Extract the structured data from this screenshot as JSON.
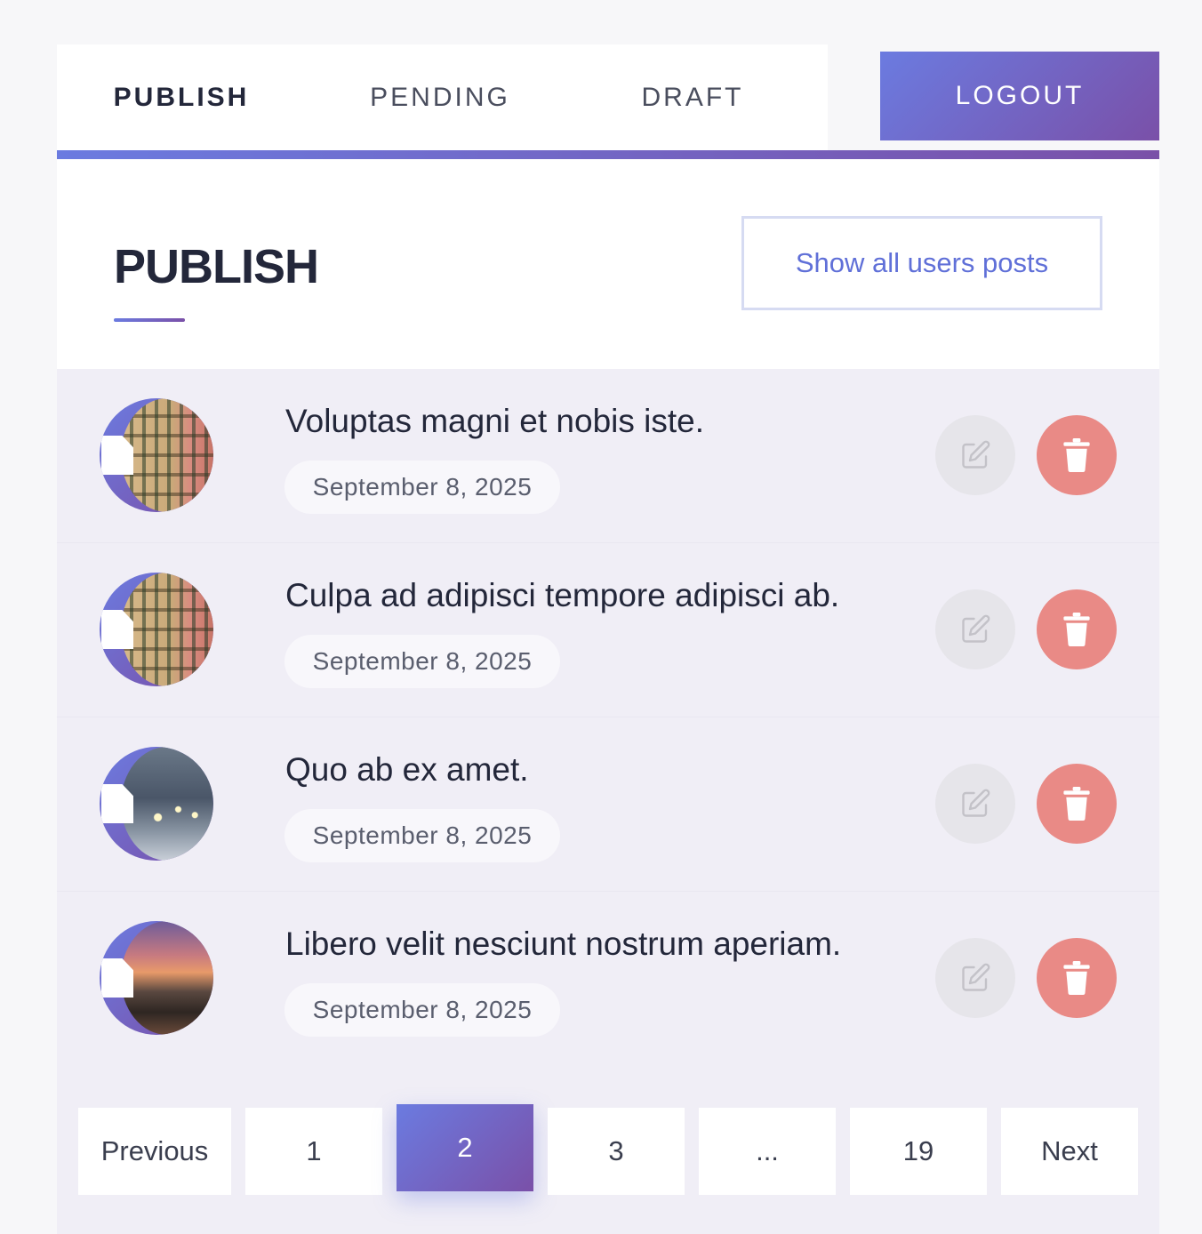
{
  "tabs": [
    {
      "label": "PUBLISH",
      "active": true
    },
    {
      "label": "PENDING",
      "active": false
    },
    {
      "label": "DRAFT",
      "active": false
    }
  ],
  "logout_label": "LOGOUT",
  "header": {
    "title": "PUBLISH",
    "show_all_label": "Show all users posts"
  },
  "posts": [
    {
      "title": "Voluptas magni et nobis iste.",
      "date": "September 8, 2025",
      "thumbnail": "building"
    },
    {
      "title": "Culpa ad adipisci tempore adipisci ab.",
      "date": "September 8, 2025",
      "thumbnail": "building"
    },
    {
      "title": "Quo ab ex amet.",
      "date": "September 8, 2025",
      "thumbnail": "winter-street"
    },
    {
      "title": "Libero velit nesciunt nostrum aperiam.",
      "date": "September 8, 2025",
      "thumbnail": "sunset-path"
    }
  ],
  "pagination": {
    "previous": "Previous",
    "pages": [
      "1",
      "2",
      "3",
      "...",
      "19"
    ],
    "current": "2",
    "next": "Next"
  },
  "colors": {
    "accent_start": "#6b7be0",
    "accent_end": "#7a50a8",
    "delete": "#e98a86",
    "edit": "#e6e5ea"
  },
  "icons": {
    "edit": "pencil-square-icon",
    "delete": "trash-icon",
    "avatar_badge": "document-icon"
  }
}
